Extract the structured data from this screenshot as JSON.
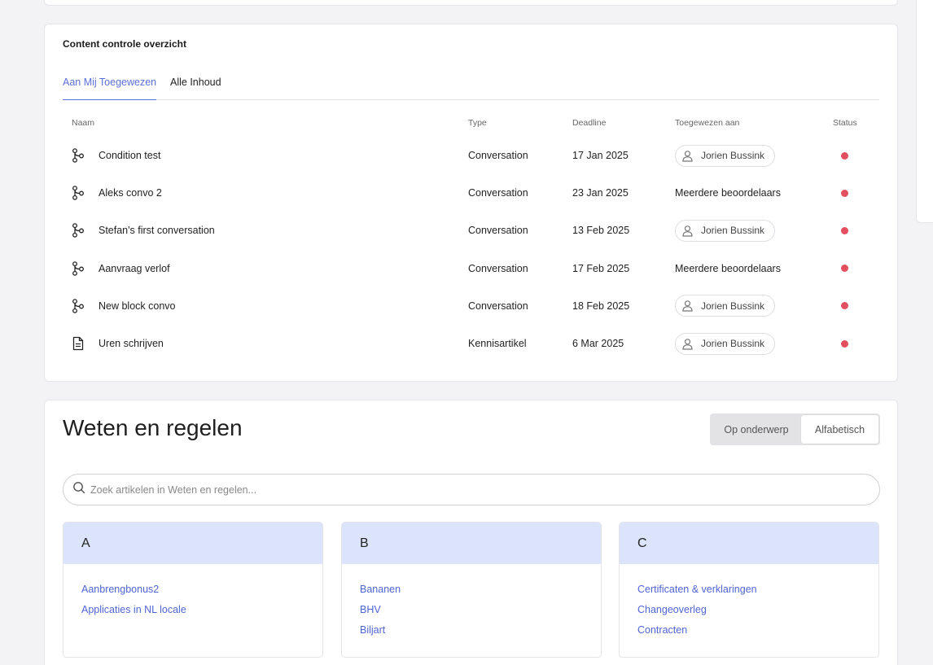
{
  "content_controle": {
    "title": "Content controle overzicht",
    "tabs": [
      {
        "label": "Aan Mij Toegewezen",
        "active": true
      },
      {
        "label": "Alle Inhoud",
        "active": false
      }
    ],
    "columns": {
      "name": "Naam",
      "type": "Type",
      "deadline": "Deadline",
      "assigned": "Toegewezen aan",
      "status": "Status"
    },
    "rows": [
      {
        "icon": "flow-icon",
        "name": "Condition test",
        "type": "Conversation",
        "deadline": "17 Jan 2025",
        "assigned": "Jorien Bussink",
        "assigned_chip": true,
        "status_color": "#e24f5e"
      },
      {
        "icon": "flow-icon",
        "name": "Aleks convo 2",
        "type": "Conversation",
        "deadline": "23 Jan 2025",
        "assigned": "Meerdere beoordelaars",
        "assigned_chip": false,
        "status_color": "#e24f5e"
      },
      {
        "icon": "flow-icon",
        "name": "Stefan's first conversation",
        "type": "Conversation",
        "deadline": "13 Feb 2025",
        "assigned": "Jorien Bussink",
        "assigned_chip": true,
        "status_color": "#e24f5e"
      },
      {
        "icon": "flow-icon",
        "name": "Aanvraag verlof",
        "type": "Conversation",
        "deadline": "17 Feb 2025",
        "assigned": "Meerdere beoordelaars",
        "assigned_chip": false,
        "status_color": "#e24f5e"
      },
      {
        "icon": "flow-icon",
        "name": "New block convo",
        "type": "Conversation",
        "deadline": "18 Feb 2025",
        "assigned": "Jorien Bussink",
        "assigned_chip": true,
        "status_color": "#e24f5e"
      },
      {
        "icon": "document-icon",
        "name": "Uren schrijven",
        "type": "Kennisartikel",
        "deadline": "6 Mar 2025",
        "assigned": "Jorien Bussink",
        "assigned_chip": true,
        "status_color": "#e24f5e"
      }
    ]
  },
  "weten": {
    "title": "Weten en regelen",
    "toggle": [
      {
        "label": "Op onderwerp",
        "active": false
      },
      {
        "label": "Alfabetisch",
        "active": true
      }
    ],
    "search_placeholder": "Zoek artikelen in Weten en regelen...",
    "letters": [
      {
        "letter": "A",
        "items": [
          "Aanbrengbonus2",
          "Applicaties in NL locale"
        ]
      },
      {
        "letter": "B",
        "items": [
          "Bananen",
          "BHV",
          "Biljart"
        ]
      },
      {
        "letter": "C",
        "items": [
          "Certificaten & verklaringen",
          "Changeoverleg",
          "Contracten"
        ]
      }
    ]
  },
  "colors": {
    "accent": "#5a6fd8",
    "link": "#4e64d4",
    "letter_header": "#dbe4fb",
    "status_red": "#e24f5e"
  }
}
